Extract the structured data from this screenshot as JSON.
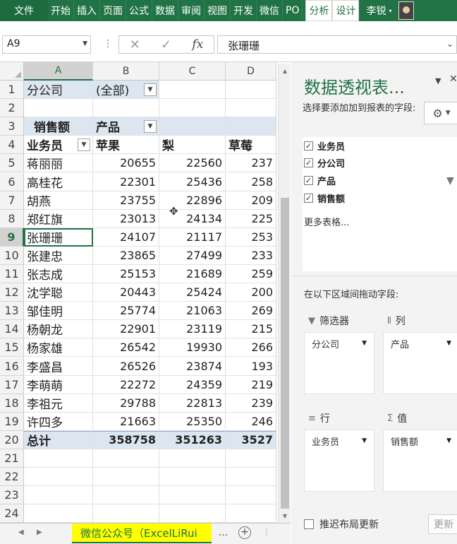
{
  "ribbon": {
    "file": "文件",
    "tabs": [
      "开始",
      "插入",
      "页面",
      "公式",
      "数据",
      "审阅",
      "视图",
      "开发",
      "微信",
      "PO"
    ],
    "context_tabs": [
      "分析",
      "设计"
    ],
    "user": "李锐"
  },
  "formula_bar": {
    "name_box": "A9",
    "formula": "张珊珊",
    "cancel_glyph": "✕",
    "enter_glyph": "✓",
    "fx_glyph": "fx"
  },
  "grid": {
    "columns": [
      "A",
      "B",
      "C",
      "D"
    ],
    "selected_column": "A",
    "selected_row": "9",
    "rows": [
      {
        "n": "1",
        "cells": [
          "分公司",
          "(全部)",
          "",
          ""
        ]
      },
      {
        "n": "2",
        "cells": [
          "",
          "",
          "",
          ""
        ]
      },
      {
        "n": "3",
        "cells": [
          "销售额",
          "产品",
          "",
          ""
        ]
      },
      {
        "n": "4",
        "cells": [
          "业务员",
          "苹果",
          "梨",
          "草莓"
        ]
      },
      {
        "n": "5",
        "cells": [
          "蒋丽丽",
          "20655",
          "22560",
          "237"
        ]
      },
      {
        "n": "6",
        "cells": [
          "高桂花",
          "22301",
          "25436",
          "258"
        ]
      },
      {
        "n": "7",
        "cells": [
          "胡燕",
          "23755",
          "22896",
          "209"
        ]
      },
      {
        "n": "8",
        "cells": [
          "郑红旗",
          "23013",
          "24134",
          "225"
        ]
      },
      {
        "n": "9",
        "cells": [
          "张珊珊",
          "24107",
          "21117",
          "253"
        ]
      },
      {
        "n": "10",
        "cells": [
          "张建忠",
          "23865",
          "27499",
          "233"
        ]
      },
      {
        "n": "11",
        "cells": [
          "张志成",
          "25153",
          "21689",
          "259"
        ]
      },
      {
        "n": "12",
        "cells": [
          "沈学聪",
          "20443",
          "25424",
          "200"
        ]
      },
      {
        "n": "13",
        "cells": [
          "邹佳明",
          "25774",
          "21063",
          "269"
        ]
      },
      {
        "n": "14",
        "cells": [
          "杨朝龙",
          "22901",
          "23119",
          "215"
        ]
      },
      {
        "n": "15",
        "cells": [
          "杨家雄",
          "26542",
          "19930",
          "266"
        ]
      },
      {
        "n": "16",
        "cells": [
          "李盛昌",
          "26526",
          "23874",
          "193"
        ]
      },
      {
        "n": "17",
        "cells": [
          "李萌萌",
          "22272",
          "24359",
          "219"
        ]
      },
      {
        "n": "18",
        "cells": [
          "李祖元",
          "29788",
          "22813",
          "239"
        ]
      },
      {
        "n": "19",
        "cells": [
          "许四多",
          "21663",
          "25350",
          "246"
        ]
      },
      {
        "n": "20",
        "cells": [
          "总计",
          "358758",
          "351263",
          "3527"
        ]
      },
      {
        "n": "21",
        "cells": [
          "",
          "",
          "",
          ""
        ]
      },
      {
        "n": "22",
        "cells": [
          "",
          "",
          "",
          ""
        ]
      },
      {
        "n": "23",
        "cells": [
          "",
          "",
          "",
          ""
        ]
      },
      {
        "n": "24",
        "cells": [
          "",
          "",
          "",
          ""
        ]
      }
    ]
  },
  "sheet_bar": {
    "tab": "微信公众号（ExcelLiRui",
    "ellipsis": "...",
    "add": "+"
  },
  "pivot_pane": {
    "title": "数据透视表...",
    "description": "选择要添加加到报表的字段:",
    "fields": [
      {
        "label": "业务员",
        "checked": "✓"
      },
      {
        "label": "分公司",
        "checked": "✓"
      },
      {
        "label": "产品",
        "checked": "✓"
      },
      {
        "label": "销售额",
        "checked": "✓"
      }
    ],
    "more_tables": "更多表格...",
    "drag_label": "在以下区域间拖动字段:",
    "areas": {
      "filters": {
        "label": "筛选器",
        "field": "分公司"
      },
      "columns": {
        "label": "列",
        "field": "产品"
      },
      "rows": {
        "label": "行",
        "field": "业务员"
      },
      "values": {
        "label": "值",
        "field": "销售额"
      }
    },
    "defer_label": "推迟布局更新",
    "update_label": "更新"
  }
}
